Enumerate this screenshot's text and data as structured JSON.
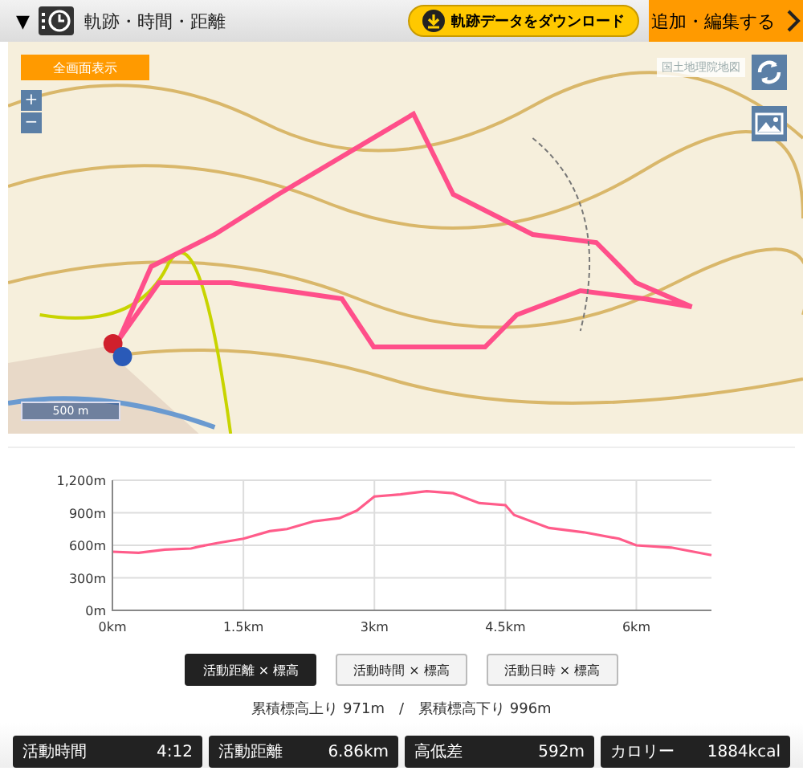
{
  "header": {
    "toggle": "▼",
    "title": "軌跡・時間・距離",
    "download_button": "軌跡データをダウンロード",
    "edit_button": "追加・編集する"
  },
  "map": {
    "fullscreen_button": "全画面表示",
    "zoom_in": "+",
    "zoom_out": "−",
    "attribution": "国土地理院地図",
    "scale": "500 m"
  },
  "chart": {
    "chart_data": {
      "type": "line",
      "x": [
        0,
        0.3,
        0.6,
        0.9,
        1.0,
        1.2,
        1.5,
        1.8,
        2.0,
        2.3,
        2.6,
        2.8,
        3.0,
        3.3,
        3.6,
        3.9,
        4.2,
        4.5,
        4.6,
        5.0,
        5.4,
        5.8,
        6.0,
        6.4,
        6.86
      ],
      "grid": true,
      "series": [
        {
          "color": "#ff5c8a",
          "values": [
            540,
            530,
            560,
            570,
            590,
            620,
            660,
            730,
            750,
            820,
            850,
            920,
            1050,
            1070,
            1100,
            1080,
            990,
            970,
            880,
            760,
            720,
            660,
            600,
            580,
            510
          ]
        }
      ],
      "xlim": [
        0,
        6.86
      ],
      "ylim": [
        0,
        1200
      ],
      "xticks": [
        {
          "value": 0,
          "label": "0km"
        },
        {
          "value": 1.5,
          "label": "1.5km"
        },
        {
          "value": 3,
          "label": "3km"
        },
        {
          "value": 4.5,
          "label": "4.5km"
        },
        {
          "value": 6,
          "label": "6km"
        }
      ],
      "yticks": [
        {
          "value": 0,
          "label": "0m"
        },
        {
          "value": 300,
          "label": "300m"
        },
        {
          "value": 600,
          "label": "600m"
        },
        {
          "value": 900,
          "label": "900m"
        },
        {
          "value": 1200,
          "label": "1,200m"
        }
      ]
    }
  },
  "chart_modes": [
    {
      "label": "活動距離 × 標高",
      "selected": true
    },
    {
      "label": "活動時間 × 標高",
      "selected": false
    },
    {
      "label": "活動日時 × 標高",
      "selected": false
    }
  ],
  "elevation_summary": "累積標高上り 971m　/　累積標高下り 996m",
  "stats": [
    {
      "label": "活動時間",
      "value": "4:12"
    },
    {
      "label": "活動距離",
      "value": "6.86km"
    },
    {
      "label": "高低差",
      "value": "592m"
    },
    {
      "label": "カロリー",
      "value": "1884kcal"
    }
  ]
}
